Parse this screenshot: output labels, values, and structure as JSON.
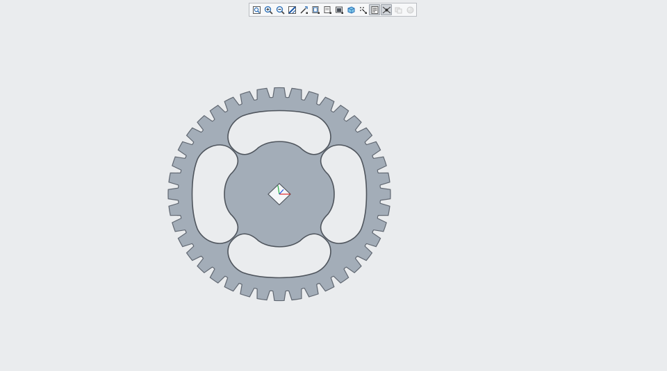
{
  "toolbar": {
    "buttons": [
      {
        "icon": "refit-icon",
        "state": "normal"
      },
      {
        "icon": "zoom-in-icon",
        "state": "normal"
      },
      {
        "icon": "zoom-out-icon",
        "state": "normal"
      },
      {
        "icon": "repaint-icon",
        "state": "normal"
      },
      {
        "icon": "reorient-icon",
        "state": "normal"
      },
      {
        "icon": "saved-orientations-icon",
        "state": "normal"
      },
      {
        "icon": "view-manager-icon",
        "state": "normal"
      },
      {
        "icon": "display-style-icon",
        "state": "normal"
      },
      {
        "icon": "perspective-view-icon",
        "state": "normal"
      },
      {
        "icon": "datum-display-icon",
        "state": "normal"
      },
      {
        "icon": "annotation-display-icon",
        "state": "active"
      },
      {
        "icon": "spin-center-icon",
        "state": "active"
      },
      {
        "icon": "show-hidden-icon",
        "state": "disabled"
      },
      {
        "icon": "appearance-icon",
        "state": "disabled"
      }
    ]
  },
  "model": {
    "part": "sprocket",
    "teeth": 40,
    "fill_color": "#a3adb8",
    "edge_color": "#5f6670",
    "background_color": "#eaecee",
    "axis_colors": {
      "x": "#e02020",
      "y": "#20b040",
      "z": "#2050e0"
    }
  }
}
